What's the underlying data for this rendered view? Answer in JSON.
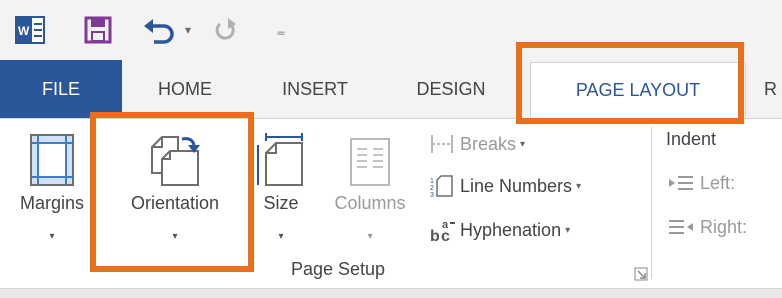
{
  "quick_access": {
    "app_icon": "word-app-icon",
    "save_icon": "save-icon",
    "undo_icon": "undo-icon",
    "undo_dropdown": "▾",
    "redo_icon": "redo-icon",
    "customize_icon": "customize-qat-icon",
    "customize_glyph": "₌"
  },
  "tabs": [
    {
      "label": "FILE"
    },
    {
      "label": "HOME"
    },
    {
      "label": "INSERT"
    },
    {
      "label": "DESIGN"
    },
    {
      "label": "PAGE LAYOUT",
      "active": true
    },
    {
      "label": "R"
    }
  ],
  "page_setup": {
    "group_label": "Page Setup",
    "margins": {
      "label": "Margins",
      "dropdown": "▾",
      "icon": "margins-icon"
    },
    "orientation": {
      "label": "Orientation",
      "dropdown": "▾",
      "icon": "orientation-icon"
    },
    "size": {
      "label": "Size",
      "dropdown": "▾",
      "icon": "size-icon"
    },
    "columns": {
      "label": "Columns",
      "dropdown": "▾",
      "icon": "columns-icon",
      "disabled": true
    },
    "breaks": {
      "label": "Breaks",
      "dropdown": "▾",
      "icon": "breaks-icon",
      "disabled": true
    },
    "line_numbers": {
      "label": "Line Numbers",
      "dropdown": "▾",
      "icon": "line-numbers-icon"
    },
    "hyphenation": {
      "label": "Hyphenation",
      "dropdown": "▾",
      "icon": "hyphenation-icon"
    },
    "launcher_icon": "dialog-launcher-icon"
  },
  "paragraph": {
    "indent_title": "Indent",
    "left_label": "Left:",
    "right_label": "Right:",
    "left_icon": "indent-left-icon",
    "right_icon": "indent-right-icon"
  },
  "colors": {
    "file_tab": "#2b579a",
    "active_tab_text": "#2b579a",
    "highlight": "#e8701d",
    "disabled_text": "#9a9a9a",
    "save_icon": "#7e3a96",
    "undo_icon": "#2b579a"
  },
  "highlights": [
    "PAGE LAYOUT tab",
    "Orientation button"
  ]
}
